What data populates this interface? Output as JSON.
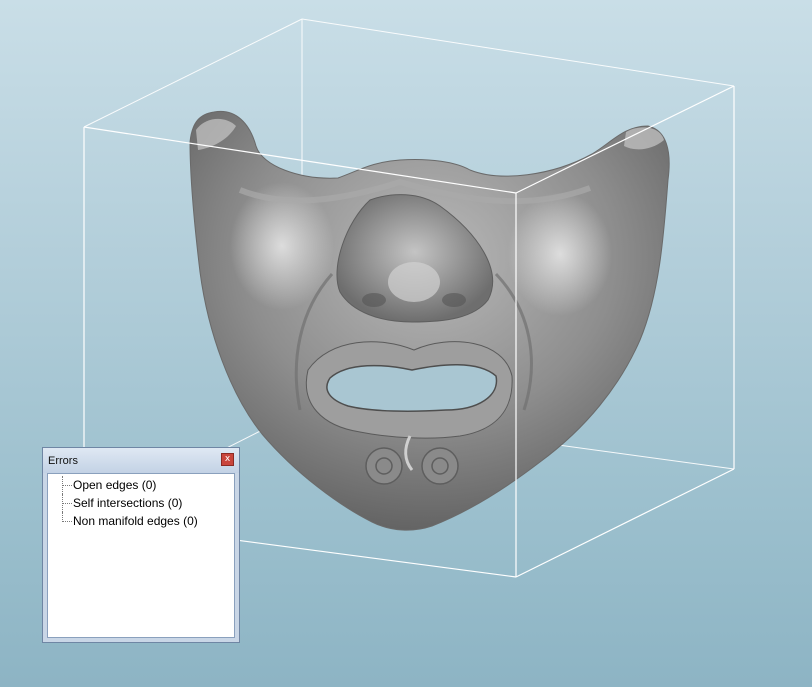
{
  "errors_panel": {
    "title": "Errors",
    "close_glyph": "x",
    "items": [
      {
        "label": "Open edges (0)"
      },
      {
        "label": "Self intersections (0)"
      },
      {
        "label": "Non manifold edges (0)"
      }
    ]
  },
  "colors": {
    "background_top": "#c9dee7",
    "background_bottom": "#8db4c4",
    "bounding_box": "#ffffff",
    "mesh": "#8c8c8c"
  },
  "icons": {
    "close": "close-icon"
  }
}
